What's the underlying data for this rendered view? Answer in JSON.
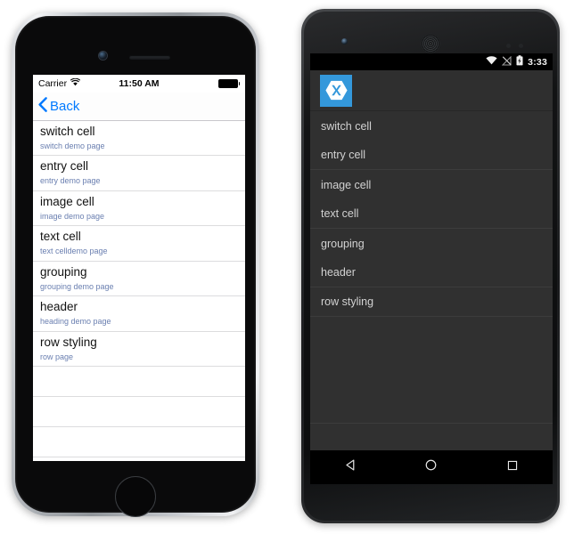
{
  "ios": {
    "status_bar": {
      "carrier": "Carrier",
      "wifi_icon": "wifi-icon",
      "time": "11:50 AM",
      "battery_icon": "battery-full-icon"
    },
    "nav_bar": {
      "back_label": "Back",
      "back_icon": "chevron-left-icon"
    },
    "rows": [
      {
        "title": "switch cell",
        "detail": "switch demo page"
      },
      {
        "title": "entry cell",
        "detail": "entry demo page"
      },
      {
        "title": "image cell",
        "detail": "image demo page"
      },
      {
        "title": "text cell",
        "detail": "text celldemo page"
      },
      {
        "title": "grouping",
        "detail": "grouping demo page"
      },
      {
        "title": "header",
        "detail": "heading demo page"
      },
      {
        "title": "row styling",
        "detail": "row page"
      }
    ],
    "empty_rows": 5
  },
  "android": {
    "status_bar": {
      "wifi_icon": "wifi-icon",
      "signal_off_icon": "signal-no-sim-icon",
      "battery_icon": "battery-charging-icon",
      "time": "3:33"
    },
    "header": {
      "app_icon": "xamarin-logo-icon"
    },
    "rows": [
      {
        "title": "switch cell",
        "separator": false
      },
      {
        "title": "entry cell",
        "separator": true
      },
      {
        "title": "image cell",
        "separator": false
      },
      {
        "title": "text cell",
        "separator": true
      },
      {
        "title": "grouping",
        "separator": false
      },
      {
        "title": "header",
        "separator": true
      },
      {
        "title": "row styling",
        "separator": true
      }
    ],
    "nav_bar": {
      "back_icon": "triangle-back-icon",
      "home_icon": "circle-home-icon",
      "recents_icon": "square-recents-icon"
    }
  },
  "colors": {
    "ios_accent": "#007AFF",
    "ios_detail_text": "#6a7fb0",
    "ios_separator": "#dcdcde",
    "android_bg": "#303030",
    "android_header": "#2f2f2f",
    "android_text": "#d2d2d2",
    "xamarin_blue": "#3498db"
  }
}
